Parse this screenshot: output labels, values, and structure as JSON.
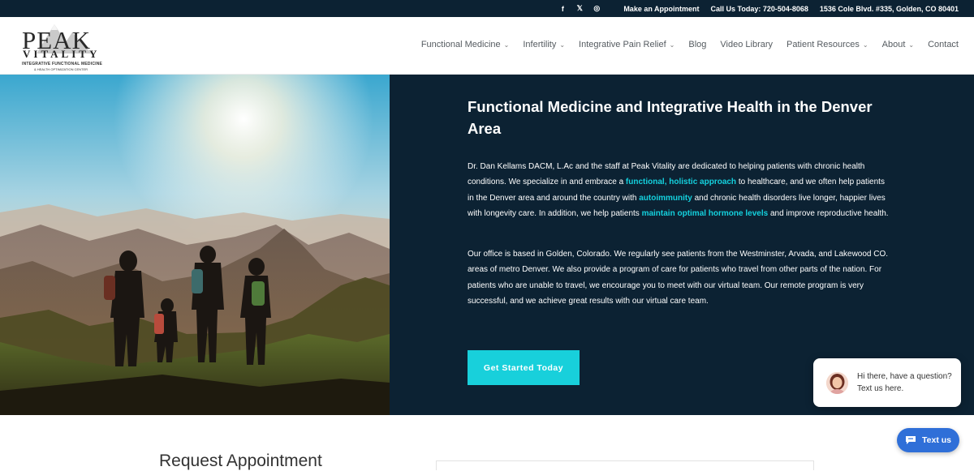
{
  "topbar": {
    "social": [
      {
        "icon": "facebook-icon",
        "glyph": "f"
      },
      {
        "icon": "x-twitter-icon",
        "glyph": "𝕏"
      },
      {
        "icon": "instagram-icon",
        "glyph": "◎"
      }
    ],
    "make_appointment": "Make an Appointment",
    "call_us": "Call Us Today: 720-504-8068",
    "address": "1536 Cole Blvd. #335, Golden, CO 80401"
  },
  "logo": {
    "name_top": "PEAK",
    "name_bottom": "VITALITY",
    "tagline_1": "INTEGRATIVE FUNCTIONAL MEDICINE",
    "tagline_2": "& HEALTH OPTIMIZATION CENTER"
  },
  "nav": [
    {
      "label": "Functional Medicine",
      "dropdown": true
    },
    {
      "label": "Infertility",
      "dropdown": true
    },
    {
      "label": "Integrative Pain Relief",
      "dropdown": true
    },
    {
      "label": "Blog",
      "dropdown": false
    },
    {
      "label": "Video Library",
      "dropdown": false
    },
    {
      "label": "Patient Resources",
      "dropdown": true
    },
    {
      "label": "About",
      "dropdown": true
    },
    {
      "label": "Contact",
      "dropdown": false
    }
  ],
  "hero": {
    "title": "Functional Medicine and Integrative Health in the Denver Area",
    "p1_a": "Dr. Dan Kellams DACM, L.Ac and the staff at Peak Vitality are dedicated to helping patients with chronic health conditions. We specialize in and embrace a ",
    "p1_link1": "functional, holistic approach",
    "p1_b": " to healthcare, and we often help patients in the Denver area and around the country with ",
    "p1_link2": "autoimmunity",
    "p1_c": " and chronic health disorders live longer, happier lives with longevity care. In addition, we help patients ",
    "p1_link3": "maintain optimal hormone levels",
    "p1_d": " and improve reproductive health.",
    "p2": "Our office is based in Golden, Colorado. We regularly see patients from the Westminster, Arvada, and Lakewood CO. areas of metro Denver. We also provide a program of care for patients who travel from other parts of the nation. For patients who are unable to travel, we encourage you to meet with our virtual team. Our remote program is very successful, and we achieve great results with our virtual care team.",
    "cta": "Get Started Today"
  },
  "below": {
    "heading": "Request Appointment"
  },
  "chat": {
    "message": "Hi there, have a question? Text us here.",
    "button": "Text us"
  },
  "colors": {
    "navy": "#0c2233",
    "accent": "#14d1de",
    "chat_blue": "#2f6fd8"
  }
}
